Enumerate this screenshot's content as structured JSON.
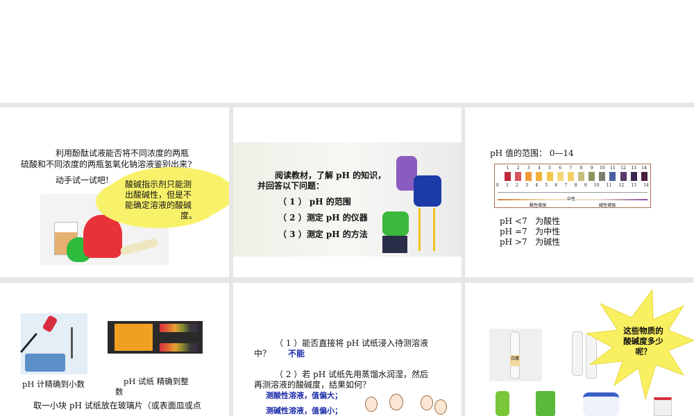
{
  "slides": [
    {
      "question_line1": "利用酚酞试液能否将不同浓度的两瓶",
      "question_line2": "硫酸和不同浓度的两瓶氢氧化钠溶液鉴别出来?",
      "try_it": "动手试一试吧!",
      "cloud_lines": [
        "酸碱指示剂只能测",
        "出酸碱性，但是不",
        "能确定溶液的酸碱",
        "度。"
      ]
    },
    {
      "intro_line1": "阅读教材，了解 pH 的知识，",
      "intro_line2": "并回答以下问题：",
      "items": [
        "（ 1 ） pH 的范围",
        "（ 2 ）测定 pH 的仪器",
        "（ 3 ）测定 pH 的方法"
      ]
    },
    {
      "range_title": "pH 值的范围： 0—14",
      "scale_numbers": [
        "0",
        "1",
        "2",
        "3",
        "4",
        "5",
        "6",
        "7",
        "8",
        "9",
        "10",
        "11",
        "12",
        "13",
        "14"
      ],
      "neutral_label": "中性",
      "acid_label": "酸性增强",
      "base_label": "碱性增强",
      "rules": [
        "pH <7   为酸性",
        "pH =7   为中性",
        "pH >7   为碱性"
      ],
      "strip_colors": [
        "#c0283c",
        "#d85560",
        "#ef9a3a",
        "#f2b23a",
        "#f4c54a",
        "#f5d77a",
        "#f4d068",
        "#c5bd7a",
        "#8c9460",
        "#7a8070",
        "#4a5fa0",
        "#5a3a6a",
        "#3a2850",
        "#4a2040"
      ]
    },
    {
      "meter_caption": "pH 计精确到小数",
      "paper_caption_line1": "pH 试纸  精确到整",
      "paper_caption_line2": "数",
      "method_line1": "取一小块 pH 试纸放在玻璃片（或表面皿或点"
    },
    {
      "q1_line1": "（ 1 ）能否直接将 pH 试纸浸入待测溶液",
      "q1_line2": "中？",
      "q1_answer": "不能",
      "q2_line1": "（ 2 ）若 pH 试纸先用蒸馏水润湿，然后",
      "q2_line2": "再测溶液的酸碱度，结果如何？",
      "a2_line1": "测酸性溶液，值偏大；",
      "a2_line2": "测碱性溶液，值偏小；"
    },
    {
      "burst_lines": [
        "这些物质的",
        "酸碱度多少",
        "呢？"
      ],
      "vinegar_label": "白醋"
    }
  ]
}
